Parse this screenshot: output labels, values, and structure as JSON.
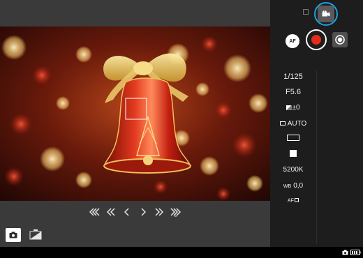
{
  "colors": {
    "panel_bg": "#1d1d1d",
    "toolbar_bg": "#3a3a3a",
    "record_red": "#e52b1b",
    "highlight_blue": "#1aa1e6"
  },
  "icons": {
    "nav": [
      "skip-back-far-icon",
      "skip-back-icon",
      "step-back-icon",
      "step-forward-icon",
      "skip-forward-icon",
      "skip-forward-far-icon"
    ],
    "modes": [
      "still-camera-icon",
      "exposure-compare-icon"
    ],
    "top_right": [
      "still-mode-icon",
      "movie-mode-icon"
    ],
    "controls": [
      "autofocus-icon",
      "record-icon",
      "shutter-icon"
    ],
    "status": [
      "camera-icon",
      "battery-icon"
    ]
  },
  "settings": {
    "shutter_speed": "1/125",
    "aperture": "F5.6",
    "exposure_comp": "±0",
    "iso": "AUTO",
    "white_balance": "0,0",
    "color_temp": "5200K",
    "af_mode": "AF"
  },
  "buttons": {
    "af_label": "AF"
  }
}
